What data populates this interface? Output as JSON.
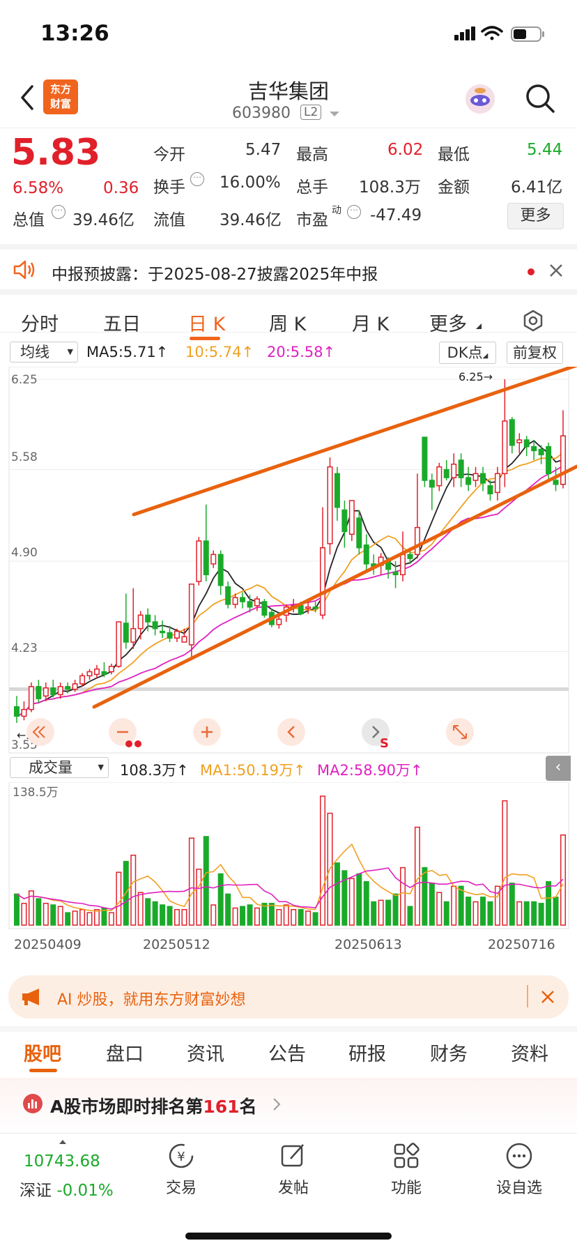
{
  "status": {
    "time": "13:26"
  },
  "header": {
    "logo_line1": "东方",
    "logo_line2": "财富",
    "title": "吉华集团",
    "code": "603980",
    "level": "L2"
  },
  "quote": {
    "price": "5.83",
    "pct": "6.58%",
    "chg": "0.36",
    "open_label": "今开",
    "open": "5.47",
    "high_label": "最高",
    "high": "6.02",
    "low_label": "最低",
    "low": "5.44",
    "turnover_label": "换手",
    "turnover": "16.00%",
    "volume_label": "总手",
    "volume": "108.3万",
    "amount_label": "金额",
    "amount": "6.41亿",
    "mcap_label": "总值",
    "mcap": "39.46亿",
    "float_label": "流值",
    "float": "39.46亿",
    "pe_label": "市盈",
    "pe_sup": "动",
    "pe": "-47.49",
    "more": "更多"
  },
  "notice": {
    "text": "中报预披露：于2025-08-27披露2025年中报"
  },
  "tabs": [
    "分时",
    "五日",
    "日 K",
    "周 K",
    "月 K",
    "更多"
  ],
  "active_tab": "日 K",
  "ma_bar": {
    "selector": "均线",
    "ma5": "MA5:5.71↑",
    "ma10": "10:5.74↑",
    "ma20": "20:5.58↑",
    "dk": "DK点",
    "adj": "前复权"
  },
  "chart_labels": {
    "y1": "6.25",
    "y2": "5.58",
    "y3": "4.90",
    "y4": "4.23",
    "y5": "3.55",
    "max_label": "6.25→",
    "min_label": "←3.55"
  },
  "vol_bar": {
    "selector": "成交量",
    "vol": "108.3万↑",
    "ma1": "MA1:50.19万↑",
    "ma2": "MA2:58.90万↑",
    "ymax": "138.5万"
  },
  "dates": [
    "20250409",
    "20250512",
    "20250613",
    "20250716"
  ],
  "ad": {
    "text": "AI 炒股，就用东方财富妙想"
  },
  "sections": [
    "股吧",
    "盘口",
    "资讯",
    "公告",
    "研报",
    "财务",
    "资料"
  ],
  "active_section": "股吧",
  "rank": {
    "prefix": "A股市场即时排名第",
    "num": "161",
    "suffix": "名"
  },
  "bottom": {
    "index_value": "10743.68",
    "index_name": "深证",
    "index_chg": "-0.01%",
    "nav": [
      "交易",
      "发帖",
      "功能",
      "设自选"
    ]
  },
  "colors": {
    "up": "#e0202a",
    "down": "#1aaa2a",
    "accent": "#f0641e",
    "ma5": "#222222",
    "ma10": "#f0a020",
    "ma20": "#e020c0"
  },
  "chart_data": {
    "type": "candlestick",
    "ylim": [
      3.55,
      6.25
    ],
    "candles": [
      [
        3.82,
        3.75,
        3.9,
        3.7
      ],
      [
        3.75,
        3.8,
        3.86,
        3.72
      ],
      [
        3.8,
        3.97,
        4.0,
        3.78
      ],
      [
        3.97,
        3.88,
        4.02,
        3.85
      ],
      [
        3.9,
        3.96,
        4.0,
        3.86
      ],
      [
        3.96,
        3.91,
        4.02,
        3.89
      ],
      [
        3.91,
        3.97,
        4.0,
        3.88
      ],
      [
        3.97,
        3.95,
        4.0,
        3.92
      ],
      [
        3.95,
        3.99,
        4.02,
        3.93
      ],
      [
        3.99,
        4.05,
        4.07,
        3.97
      ],
      [
        4.05,
        4.08,
        4.1,
        4.02
      ],
      [
        4.06,
        4.1,
        4.13,
        4.03
      ],
      [
        4.08,
        4.06,
        4.15,
        4.04
      ],
      [
        4.08,
        4.12,
        4.14,
        4.06
      ],
      [
        4.12,
        4.45,
        4.45,
        4.11
      ],
      [
        4.44,
        4.3,
        4.66,
        4.25
      ],
      [
        4.3,
        4.4,
        4.7,
        4.25
      ],
      [
        4.4,
        4.5,
        4.53,
        4.32
      ],
      [
        4.5,
        4.45,
        4.55,
        4.38
      ],
      [
        4.45,
        4.4,
        4.5,
        4.35
      ],
      [
        4.38,
        4.37,
        4.46,
        4.33
      ],
      [
        4.37,
        4.33,
        4.42,
        4.3
      ],
      [
        4.33,
        4.38,
        4.4,
        4.3
      ],
      [
        4.3,
        4.34,
        4.4,
        4.3
      ],
      [
        4.28,
        4.73,
        4.73,
        4.17
      ],
      [
        4.75,
        5.05,
        5.08,
        4.72
      ],
      [
        5.05,
        4.8,
        5.32,
        4.75
      ],
      [
        4.88,
        4.95,
        4.98,
        4.85
      ],
      [
        4.95,
        4.72,
        4.98,
        4.65
      ],
      [
        4.71,
        4.58,
        4.75,
        4.55
      ],
      [
        4.58,
        4.63,
        4.66,
        4.55
      ],
      [
        4.63,
        4.6,
        4.67,
        4.55
      ],
      [
        4.6,
        4.56,
        4.65,
        4.52
      ],
      [
        4.57,
        4.62,
        4.64,
        4.53
      ],
      [
        4.6,
        4.5,
        4.62,
        4.48
      ],
      [
        4.52,
        4.43,
        4.55,
        4.41
      ],
      [
        4.43,
        4.47,
        4.5,
        4.4
      ],
      [
        4.5,
        4.56,
        4.58,
        4.45
      ],
      [
        4.56,
        4.57,
        4.62,
        4.52
      ],
      [
        4.57,
        4.51,
        4.6,
        4.5
      ],
      [
        4.55,
        4.56,
        4.6,
        4.51
      ],
      [
        4.56,
        4.55,
        4.6,
        4.52
      ],
      [
        4.5,
        5.0,
        5.3,
        4.47
      ],
      [
        5.03,
        5.6,
        5.67,
        4.95
      ],
      [
        5.55,
        5.3,
        5.6,
        5.2
      ],
      [
        5.28,
        5.12,
        5.35,
        5.0
      ],
      [
        5.1,
        5.35,
        5.35,
        5.05
      ],
      [
        5.22,
        5.0,
        5.28,
        4.95
      ],
      [
        5.02,
        4.88,
        5.1,
        4.82
      ],
      [
        4.88,
        4.85,
        4.95,
        4.8
      ],
      [
        4.87,
        4.93,
        4.96,
        4.8
      ],
      [
        4.9,
        4.84,
        4.93,
        4.77
      ],
      [
        4.82,
        4.8,
        4.9,
        4.7
      ],
      [
        4.8,
        4.95,
        5.12,
        4.75
      ],
      [
        4.95,
        4.92,
        5.0,
        4.88
      ],
      [
        4.95,
        5.15,
        5.55,
        4.92
      ],
      [
        5.82,
        5.5,
        5.82,
        5.45
      ],
      [
        5.5,
        5.45,
        5.55,
        5.28
      ],
      [
        5.46,
        5.6,
        5.63,
        5.42
      ],
      [
        5.58,
        5.52,
        5.65,
        5.5
      ],
      [
        5.52,
        5.62,
        5.7,
        5.45
      ],
      [
        5.65,
        5.52,
        5.7,
        5.45
      ],
      [
        5.52,
        5.47,
        5.6,
        5.42
      ],
      [
        5.5,
        5.55,
        5.6,
        5.45
      ],
      [
        5.55,
        5.48,
        5.6,
        5.42
      ],
      [
        5.46,
        5.4,
        5.5,
        5.35
      ],
      [
        5.41,
        5.55,
        5.6,
        5.35
      ],
      [
        5.55,
        5.94,
        6.25,
        5.45
      ],
      [
        5.95,
        5.76,
        5.97,
        5.7
      ],
      [
        5.78,
        5.8,
        5.85,
        5.7
      ],
      [
        5.8,
        5.75,
        5.83,
        5.68
      ],
      [
        5.75,
        5.72,
        5.8,
        5.65
      ],
      [
        5.73,
        5.69,
        5.76,
        5.62
      ],
      [
        5.75,
        5.55,
        5.78,
        5.5
      ],
      [
        5.5,
        5.47,
        5.6,
        5.42
      ],
      [
        5.47,
        5.83,
        6.02,
        5.44
      ]
    ]
  }
}
